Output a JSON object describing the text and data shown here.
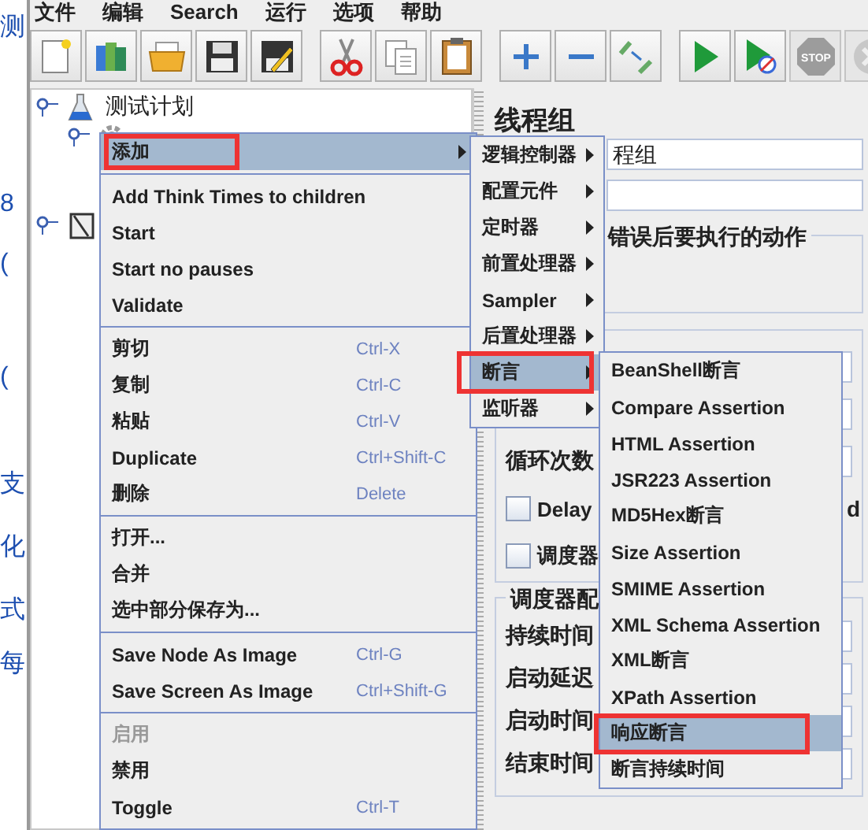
{
  "background_page": {
    "fragments": [
      "测",
      "8",
      "(",
      "(",
      "支",
      "化",
      "式",
      "每"
    ]
  },
  "menubar": [
    "文件",
    "编辑",
    "Search",
    "运行",
    "选项",
    "帮助"
  ],
  "toolbar": [
    {
      "kind": "new",
      "disabled": false
    },
    {
      "kind": "templates",
      "disabled": false
    },
    {
      "kind": "open",
      "disabled": false
    },
    {
      "kind": "save",
      "disabled": false
    },
    {
      "kind": "saveas",
      "disabled": false
    },
    {
      "kind": "cut",
      "disabled": false
    },
    {
      "kind": "copy",
      "disabled": false
    },
    {
      "kind": "paste",
      "disabled": false
    },
    {
      "kind": "expand",
      "disabled": false
    },
    {
      "kind": "collapse",
      "disabled": false
    },
    {
      "kind": "toggle",
      "disabled": false
    },
    {
      "kind": "start",
      "disabled": false
    },
    {
      "kind": "start-nopause",
      "disabled": false
    },
    {
      "kind": "stop",
      "disabled": true,
      "label": "STOP"
    },
    {
      "kind": "shutdown",
      "disabled": true
    }
  ],
  "tree": [
    {
      "label": "测试计划",
      "kind": "plan",
      "children": [
        {
          "kind": "thread-group"
        }
      ]
    },
    {
      "kind": "workbench"
    }
  ],
  "panel": {
    "title": "线程组",
    "name_value": "程组",
    "error_group": "错误后要执行的动作",
    "thread_rows": [
      {
        "kind": "field"
      },
      {
        "kind": "field"
      },
      {
        "kind": "field",
        "label": "循环次数"
      },
      {
        "kind": "checkbox",
        "label": "Delay",
        "checked": false,
        "tail": "d"
      },
      {
        "kind": "checkbox",
        "label": "调度器",
        "checked": false
      }
    ],
    "scheduler": {
      "label": "调度器配",
      "rows": [
        "持续时间",
        "启动延迟",
        "启动时间",
        "结束时间"
      ]
    }
  },
  "context_menu": {
    "sections": [
      [
        {
          "label": "添加",
          "submenu": true,
          "selected": true,
          "annotated": true,
          "disabled": false
        }
      ],
      [
        {
          "label": "Add Think Times to children",
          "selected": false,
          "annotated": false,
          "disabled": false
        },
        {
          "label": "Start",
          "selected": false,
          "annotated": false,
          "disabled": false
        },
        {
          "label": "Start no pauses",
          "selected": false,
          "annotated": false,
          "disabled": false
        },
        {
          "label": "Validate",
          "selected": false,
          "annotated": false,
          "disabled": false
        }
      ],
      [
        {
          "label": "剪切",
          "shortcut": "Ctrl-X",
          "selected": false,
          "annotated": false,
          "disabled": false
        },
        {
          "label": "复制",
          "shortcut": "Ctrl-C",
          "selected": false,
          "annotated": false,
          "disabled": false
        },
        {
          "label": "粘贴",
          "shortcut": "Ctrl-V",
          "selected": false,
          "annotated": false,
          "disabled": false
        },
        {
          "label": "Duplicate",
          "shortcut": "Ctrl+Shift-C",
          "selected": false,
          "annotated": false,
          "disabled": false
        },
        {
          "label": "删除",
          "shortcut": "Delete",
          "selected": false,
          "annotated": false,
          "disabled": false
        }
      ],
      [
        {
          "label": "打开...",
          "selected": false,
          "annotated": false,
          "disabled": false
        },
        {
          "label": "合并",
          "selected": false,
          "annotated": false,
          "disabled": false
        },
        {
          "label": "选中部分保存为...",
          "selected": false,
          "annotated": false,
          "disabled": false
        }
      ],
      [
        {
          "label": "Save Node As Image",
          "shortcut": "Ctrl-G",
          "selected": false,
          "annotated": false,
          "disabled": false
        },
        {
          "label": "Save Screen As Image",
          "shortcut": "Ctrl+Shift-G",
          "selected": false,
          "annotated": false,
          "disabled": false
        }
      ],
      [
        {
          "label": "启用",
          "selected": false,
          "annotated": false,
          "disabled": true
        },
        {
          "label": "禁用",
          "selected": false,
          "annotated": false,
          "disabled": false
        },
        {
          "label": "Toggle",
          "shortcut": "Ctrl-T",
          "selected": false,
          "annotated": false,
          "disabled": false
        }
      ]
    ]
  },
  "add_submenu": {
    "items": [
      {
        "label": "逻辑控制器",
        "selected": false,
        "annotated": false
      },
      {
        "label": "配置元件",
        "selected": false,
        "annotated": false
      },
      {
        "label": "定时器",
        "selected": false,
        "annotated": false
      },
      {
        "label": "前置处理器",
        "selected": false,
        "annotated": false
      },
      {
        "label": "Sampler",
        "selected": false,
        "annotated": false
      },
      {
        "label": "后置处理器",
        "selected": false,
        "annotated": false
      },
      {
        "label": "断言",
        "selected": true,
        "annotated": true
      },
      {
        "label": "监听器",
        "selected": false,
        "annotated": false
      }
    ]
  },
  "assertion_submenu": {
    "items": [
      {
        "label": "BeanShell断言",
        "selected": false,
        "annotated": false
      },
      {
        "label": "Compare Assertion",
        "selected": false,
        "annotated": false
      },
      {
        "label": "HTML Assertion",
        "selected": false,
        "annotated": false
      },
      {
        "label": "JSR223 Assertion",
        "selected": false,
        "annotated": false
      },
      {
        "label": "MD5Hex断言",
        "selected": false,
        "annotated": false
      },
      {
        "label": "Size Assertion",
        "selected": false,
        "annotated": false
      },
      {
        "label": "SMIME Assertion",
        "selected": false,
        "annotated": false
      },
      {
        "label": "XML Schema Assertion",
        "selected": false,
        "annotated": false
      },
      {
        "label": "XML断言",
        "selected": false,
        "annotated": false
      },
      {
        "label": "XPath Assertion",
        "selected": false,
        "annotated": false
      },
      {
        "label": "响应断言",
        "selected": true,
        "annotated": true
      },
      {
        "label": "断言持续时间",
        "selected": false,
        "annotated": false
      }
    ]
  }
}
